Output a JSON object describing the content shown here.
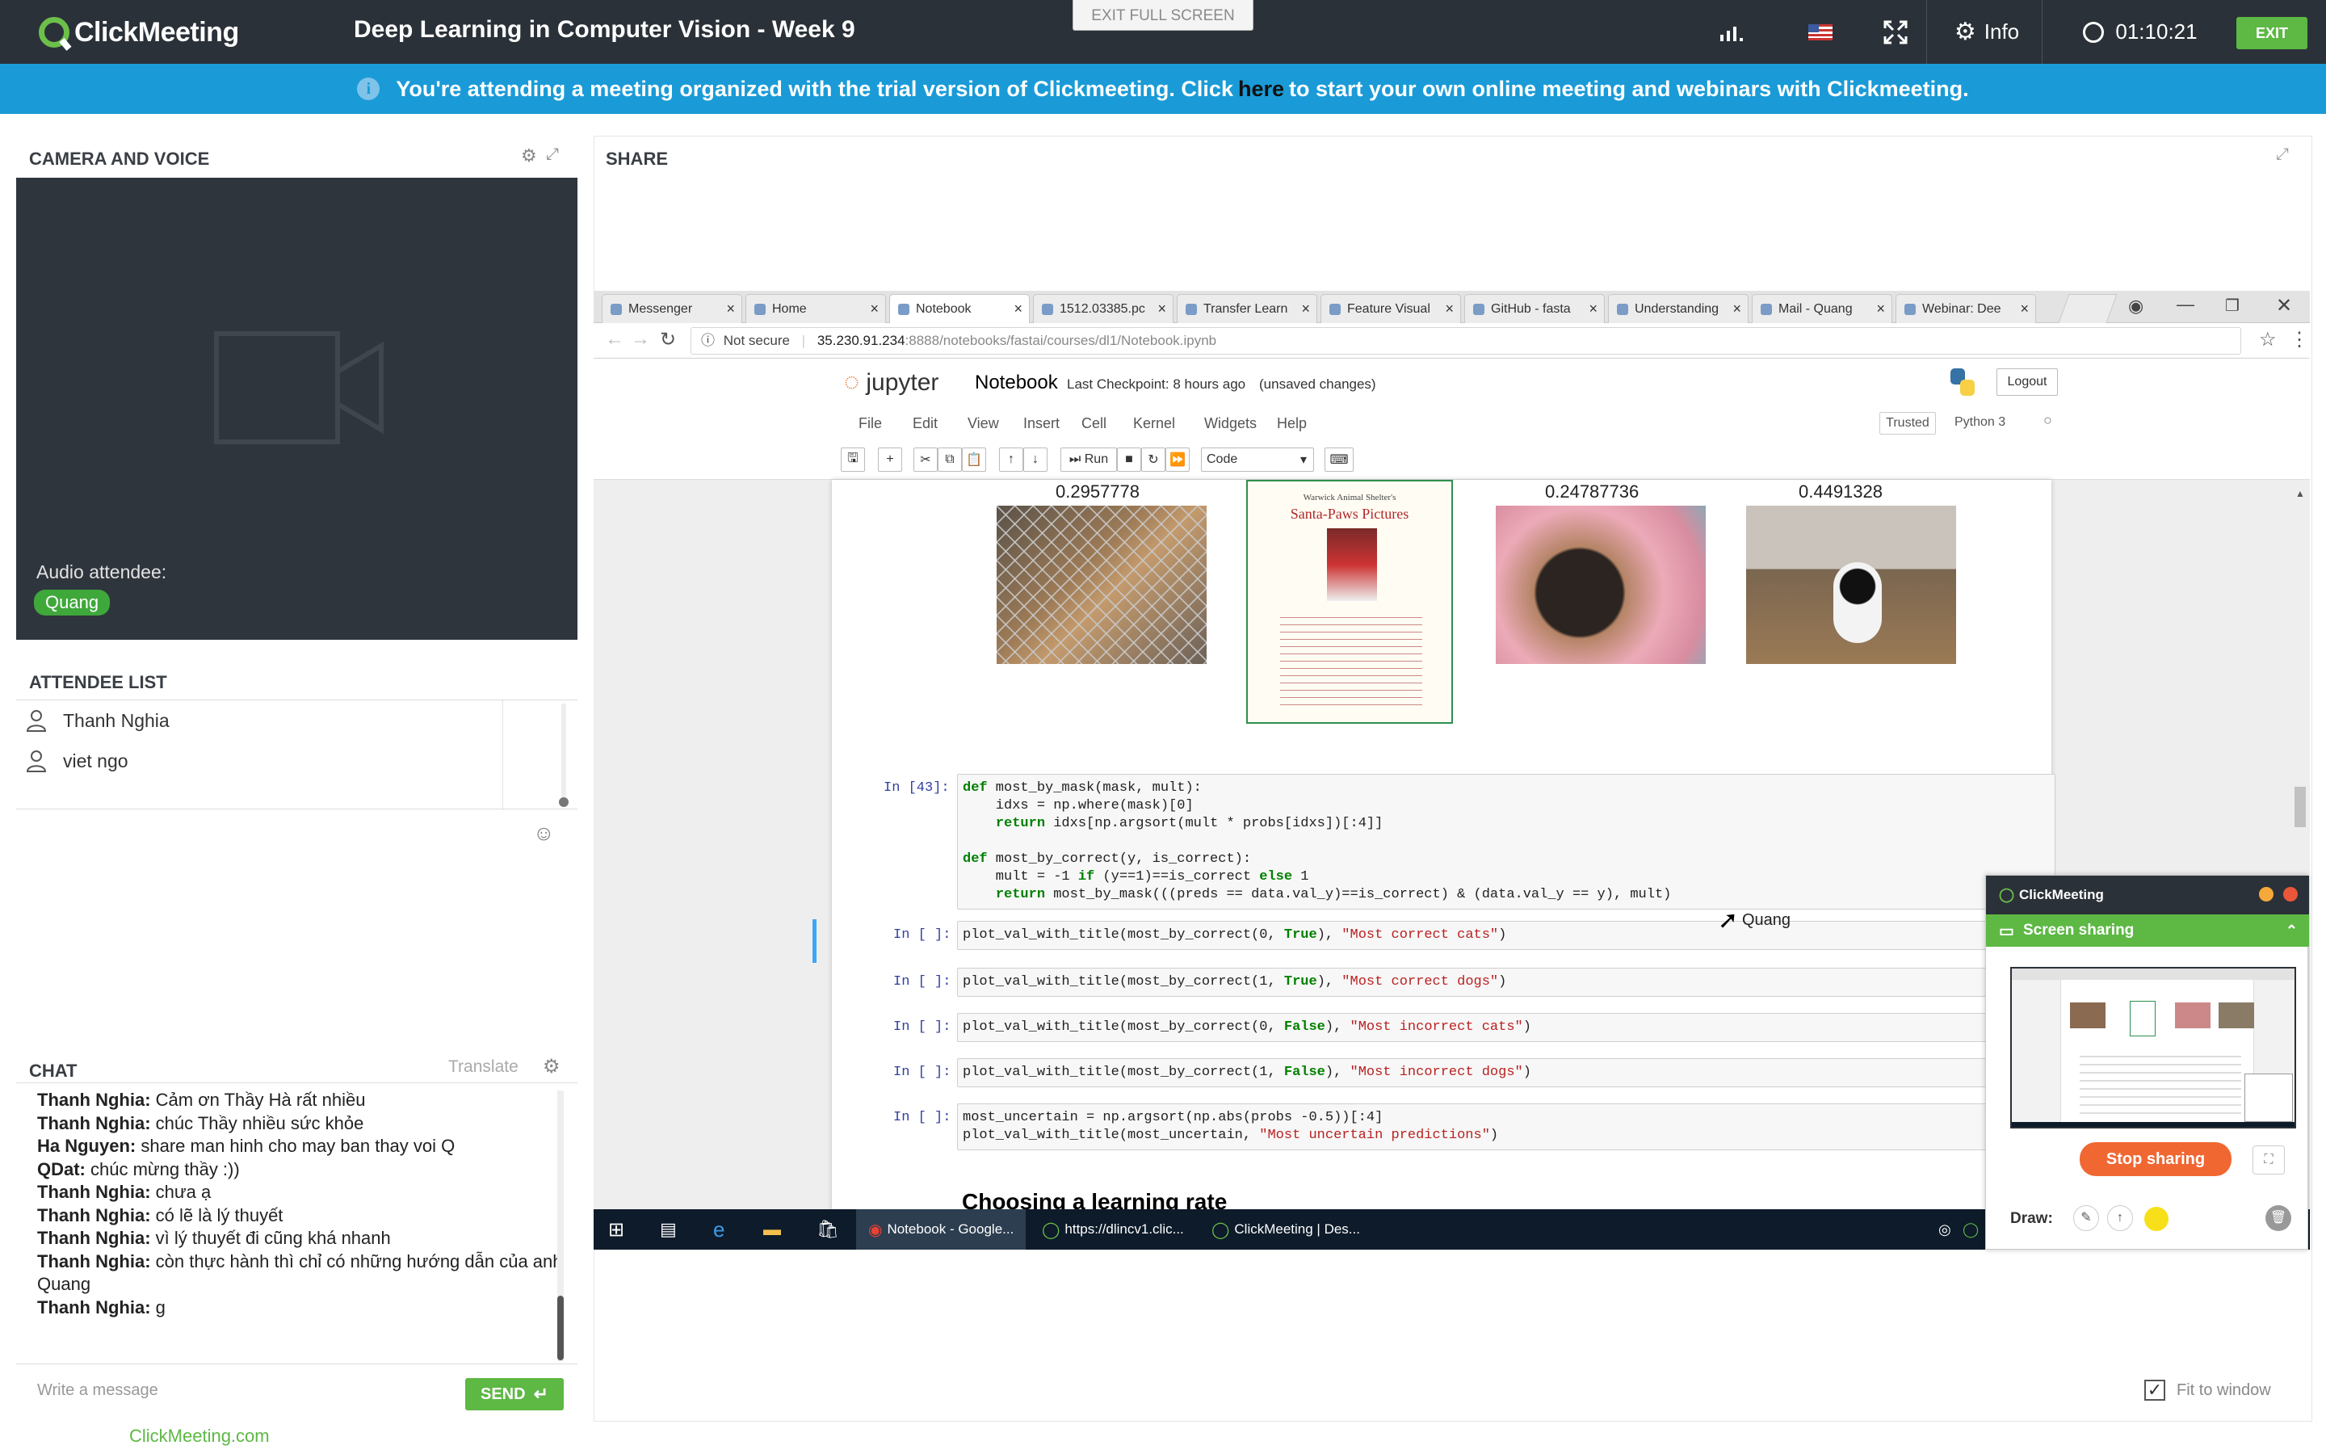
{
  "app": {
    "brand": "ClickMeeting",
    "meeting_title": "Deep Learning in Computer Vision - Week 9",
    "exit_fullscreen_label": "EXIT FULL SCREEN",
    "info_label": "Info",
    "timer": "01:10:21",
    "exit_label": "EXIT",
    "accent_color": "#5db844",
    "banner_color": "#1a9bd7"
  },
  "banner": {
    "text_before": "You're attending a meeting organized with the trial version of Clickmeeting. Click",
    "link_text": "here",
    "text_after": "to start your own online meeting and webinars with Clickmeeting."
  },
  "camera": {
    "title": "CAMERA AND VOICE",
    "audio_label": "Audio attendee:",
    "audio_attendee": "Quang"
  },
  "attendees": {
    "title": "ATTENDEE LIST",
    "items": [
      "Thanh Nghia",
      "viet ngo"
    ]
  },
  "chat": {
    "title": "CHAT",
    "translate_label": "Translate",
    "messages": [
      {
        "author": "Thanh Nghia:",
        "text": "Cảm ơn Thầy Hà rất nhiều"
      },
      {
        "author": "Thanh Nghia:",
        "text": "chúc Thầy nhiều sức khỏe"
      },
      {
        "author": "Ha Nguyen:",
        "text": "share man hinh cho may ban thay voi Q"
      },
      {
        "author": "QDat:",
        "text": "chúc mừng thầy :))"
      },
      {
        "author": "Thanh Nghia:",
        "text": "chưa ạ"
      },
      {
        "author": "Thanh Nghia:",
        "text": "có lẽ là lý thuyết"
      },
      {
        "author": "Thanh Nghia:",
        "text": "vì lý thuyết đi cũng khá nhanh"
      },
      {
        "author": "Thanh Nghia:",
        "text": "còn thực hành thì chỉ có những hướng dẫn của anh Quang"
      },
      {
        "author": "Thanh Nghia:",
        "text": "g"
      }
    ],
    "input_placeholder": "Write a message",
    "send_label": "SEND"
  },
  "footer": {
    "link": "ClickMeeting.com"
  },
  "share": {
    "title": "SHARE",
    "fit_label": "Fit to window",
    "fit_checked": true
  },
  "browser": {
    "tabs": [
      "Messenger",
      "Home",
      "Notebook",
      "1512.03385.pc",
      "Transfer Learn",
      "Feature Visual",
      "GitHub - fasta",
      "Understanding",
      "Mail - Quang",
      "Webinar: Dee"
    ],
    "active_tab": 2,
    "security": "Not secure",
    "url_host": "35.230.91.234",
    "url_path": ":8888/notebooks/fastai/courses/dl1/Notebook.ipynb"
  },
  "jupyter": {
    "logo": "jupyter",
    "name": "Notebook",
    "checkpoint": "Last Checkpoint: 8 hours ago",
    "unsaved": "(unsaved changes)",
    "logout": "Logout",
    "menu": [
      "File",
      "Edit",
      "View",
      "Insert",
      "Cell",
      "Kernel",
      "Widgets",
      "Help"
    ],
    "trusted": "Trusted",
    "kernel": "Python 3",
    "run_label": "Run",
    "cell_type": "Code",
    "probabilities": [
      "0.2957778",
      "0.24787736",
      "0.4491328"
    ],
    "poster_header": "Warwick Animal Shelter's",
    "poster_title": "Santa-Paws Pictures",
    "cells": [
      {
        "prompt": "In [43]:",
        "lines": [
          "def most_by_mask(mask, mult):",
          "    idxs = np.where(mask)[0]",
          "    return idxs[np.argsort(mult * probs[idxs])[:4]]",
          "",
          "def most_by_correct(y, is_correct):",
          "    mult = -1 if (y==1)==is_correct else 1",
          "    return most_by_mask(((preds == data.val_y)==is_correct) & (data.val_y == y), mult)"
        ]
      },
      {
        "prompt": "In [ ]:",
        "lines": [
          "plot_val_with_title(most_by_correct(0, True), \"Most correct cats\")"
        ]
      },
      {
        "prompt": "In [ ]:",
        "lines": [
          "plot_val_with_title(most_by_correct(1, True), \"Most correct dogs\")"
        ]
      },
      {
        "prompt": "In [ ]:",
        "lines": [
          "plot_val_with_title(most_by_correct(0, False), \"Most incorrect cats\")"
        ]
      },
      {
        "prompt": "In [ ]:",
        "lines": [
          "plot_val_with_title(most_by_correct(1, False), \"Most incorrect dogs\")"
        ]
      },
      {
        "prompt": "In [ ]:",
        "lines": [
          "most_uncertain = np.argsort(np.abs(probs -0.5))[:4]",
          "plot_val_with_title(most_uncertain, \"Most uncertain predictions\")"
        ]
      }
    ],
    "heading": "Choosing a learning rate",
    "cursor_label": "Quang"
  },
  "taskbar": {
    "items": [
      "Notebook - Google...",
      "https://dlincv1.clic...",
      "ClickMeeting | Des..."
    ]
  },
  "widget": {
    "brand": "ClickMeeting",
    "screen_sharing_label": "Screen sharing",
    "stop_label": "Stop sharing",
    "draw_label": "Draw:"
  }
}
